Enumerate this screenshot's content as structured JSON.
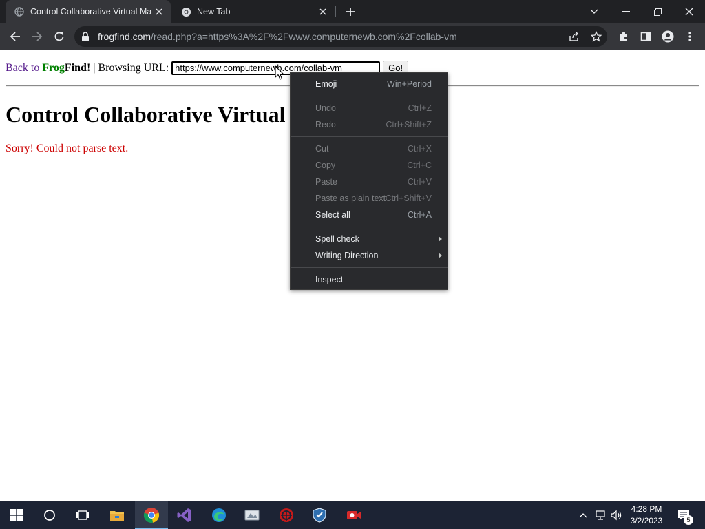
{
  "browser": {
    "tabs": [
      {
        "title": "Control Collaborative Virtual Mac",
        "favicon": "globe-icon",
        "active": true
      },
      {
        "title": "New Tab",
        "favicon": "chrome-icon",
        "active": false
      }
    ],
    "address": {
      "host": "frogfind.com",
      "path": "/read.php?a=https%3A%2F%2Fwww.computernewb.com%2Fcollab-vm"
    }
  },
  "page": {
    "back_link": {
      "prefix": "Back to ",
      "frog": "Frog",
      "find": "Find!"
    },
    "separator": " | ",
    "browsing_label": "Browsing URL:",
    "url_value": "https://www.computernewb.com/collab-vm",
    "go_label": "Go!",
    "heading": "Control Collaborative Virtual Machines",
    "error": "Sorry! Could not parse text."
  },
  "context_menu": {
    "items": [
      {
        "label": "Emoji",
        "shortcut": "Win+Period",
        "disabled": false
      },
      {
        "label": "Undo",
        "shortcut": "Ctrl+Z",
        "disabled": true
      },
      {
        "label": "Redo",
        "shortcut": "Ctrl+Shift+Z",
        "disabled": true
      },
      {
        "label": "Cut",
        "shortcut": "Ctrl+X",
        "disabled": true
      },
      {
        "label": "Copy",
        "shortcut": "Ctrl+C",
        "disabled": true
      },
      {
        "label": "Paste",
        "shortcut": "Ctrl+V",
        "disabled": true
      },
      {
        "label": "Paste as plain text",
        "shortcut": "Ctrl+Shift+V",
        "disabled": true
      },
      {
        "label": "Select all",
        "shortcut": "Ctrl+A",
        "disabled": false
      },
      {
        "label": "Spell check",
        "shortcut": "",
        "disabled": false
      },
      {
        "label": "Writing Direction",
        "shortcut": "",
        "disabled": false
      },
      {
        "label": "Inspect",
        "shortcut": "",
        "disabled": false
      }
    ]
  },
  "taskbar": {
    "apps": [
      "start-icon",
      "cortana-icon",
      "task-view-icon",
      "file-explorer-icon",
      "chrome-icon",
      "visual-studio-icon",
      "edge-icon",
      "app-icon",
      "red-app-icon",
      "shield-app-icon",
      "recorder-icon"
    ],
    "time": "4:28 PM",
    "date": "3/2/2023",
    "notification_count": "5"
  },
  "colors": {
    "tab_strip": "#202124",
    "toolbar": "#35363a",
    "menu_bg": "#292a2d",
    "taskbar": "#1c2334",
    "link_visited": "#551a8b",
    "frog_green": "#008000",
    "error_red": "#cc0000"
  }
}
